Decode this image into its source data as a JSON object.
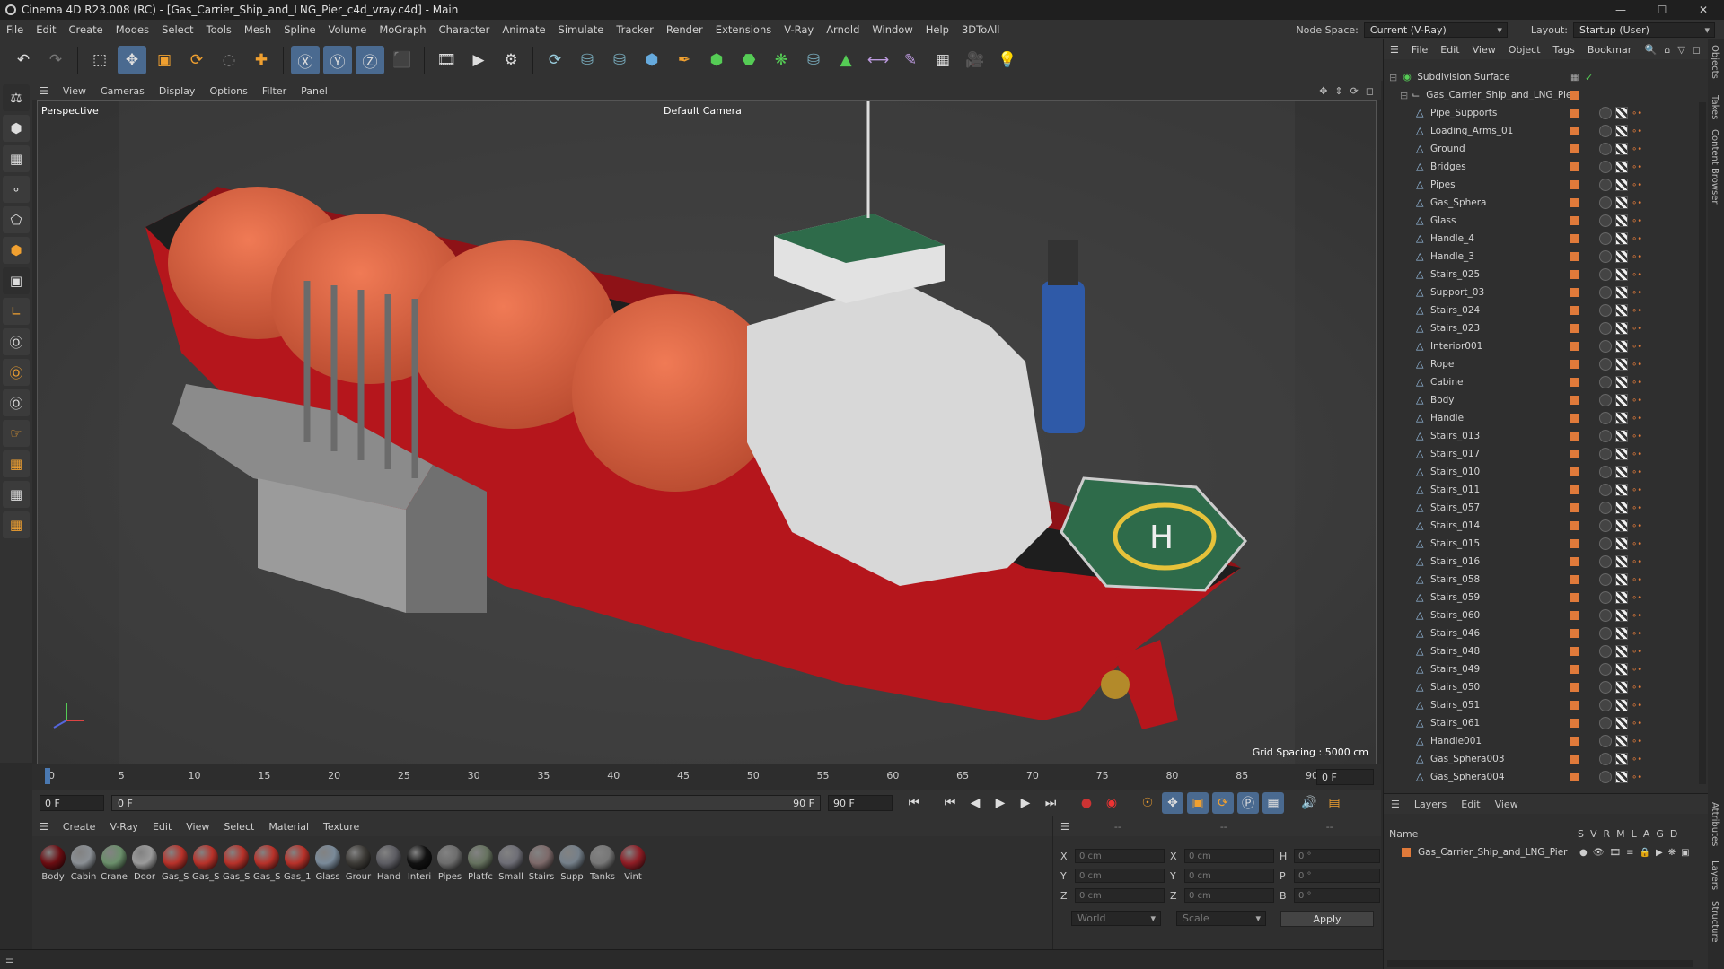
{
  "title": "Cinema 4D R23.008 (RC) - [Gas_Carrier_Ship_and_LNG_Pier_c4d_vray.c4d] - Main",
  "menu": [
    "File",
    "Edit",
    "Create",
    "Modes",
    "Select",
    "Tools",
    "Mesh",
    "Spline",
    "Volume",
    "MoGraph",
    "Character",
    "Animate",
    "Simulate",
    "Tracker",
    "Render",
    "Extensions",
    "V-Ray",
    "Arnold",
    "Window",
    "Help",
    "3DToAll"
  ],
  "node_space_label": "Node Space:",
  "node_space_value": "Current (V-Ray)",
  "layout_label": "Layout:",
  "layout_value": "Startup (User)",
  "viewport_menu": [
    "View",
    "Cameras",
    "Display",
    "Options",
    "Filter",
    "Panel"
  ],
  "viewport": {
    "name": "Perspective",
    "camera": "Default Camera",
    "grid_spacing": "Grid Spacing : 5000 cm"
  },
  "timeline": {
    "ticks": [
      "0",
      "5",
      "10",
      "15",
      "20",
      "25",
      "30",
      "35",
      "40",
      "45",
      "50",
      "55",
      "60",
      "65",
      "70",
      "75",
      "80",
      "85",
      "90"
    ],
    "current_frame": "0 F"
  },
  "transport": {
    "start": "0 F",
    "range_start": "0 F",
    "range_end": "90 F",
    "end": "90 F"
  },
  "material_menu": [
    "Create",
    "V-Ray",
    "Edit",
    "View",
    "Select",
    "Material",
    "Texture"
  ],
  "materials": [
    {
      "name": "Body",
      "color": "#6b0d12"
    },
    {
      "name": "Cabin",
      "color": "#8a8f94"
    },
    {
      "name": "Crane",
      "color": "#6b8f6b"
    },
    {
      "name": "Door",
      "color": "#9a9a9a"
    },
    {
      "name": "Gas_S",
      "color": "#b8322a"
    },
    {
      "name": "Gas_S",
      "color": "#b8322a"
    },
    {
      "name": "Gas_S",
      "color": "#b8322a"
    },
    {
      "name": "Gas_S",
      "color": "#b8322a"
    },
    {
      "name": "Gas_1",
      "color": "#b8322a"
    },
    {
      "name": "Glass",
      "color": "#7a8a99"
    },
    {
      "name": "Grour",
      "color": "#3c3a36"
    },
    {
      "name": "Hand",
      "color": "#5d5d63"
    },
    {
      "name": "Interi",
      "color": "#111111"
    },
    {
      "name": "Pipes",
      "color": "#6d6d6d"
    },
    {
      "name": "Platfc",
      "color": "#66725f"
    },
    {
      "name": "Small",
      "color": "#6e6e76"
    },
    {
      "name": "Stairs",
      "color": "#7d6a6a"
    },
    {
      "name": "Supp",
      "color": "#75808a"
    },
    {
      "name": "Tanks",
      "color": "#777777"
    },
    {
      "name": "Vint",
      "color": "#8f1d25"
    }
  ],
  "coords": {
    "x_pos": "0 cm",
    "y_pos": "0 cm",
    "z_pos": "0 cm",
    "x_size": "0 cm",
    "y_size": "0 cm",
    "z_size": "0 cm",
    "h": "0 °",
    "p": "0 °",
    "b": "0 °",
    "mode1": "World",
    "mode2": "Scale",
    "apply": "Apply",
    "header1": "--",
    "header2": "--",
    "header3": "--"
  },
  "object_menu": [
    "File",
    "Edit",
    "View",
    "Object",
    "Tags",
    "Bookmar"
  ],
  "objects_root": "Subdivision Surface",
  "objects_group": "Gas_Carrier_Ship_and_LNG_Pier",
  "objects": [
    "Pipe_Supports",
    "Loading_Arms_01",
    "Ground",
    "Bridges",
    "Pipes",
    "Gas_Sphera",
    "Glass",
    "Handle_4",
    "Handle_3",
    "Stairs_025",
    "Support_03",
    "Stairs_024",
    "Stairs_023",
    "Interior001",
    "Rope",
    "Cabine",
    "Body",
    "Handle",
    "Stairs_013",
    "Stairs_017",
    "Stairs_010",
    "Stairs_011",
    "Stairs_057",
    "Stairs_014",
    "Stairs_015",
    "Stairs_016",
    "Stairs_058",
    "Stairs_059",
    "Stairs_060",
    "Stairs_046",
    "Stairs_048",
    "Stairs_049",
    "Stairs_050",
    "Stairs_051",
    "Stairs_061",
    "Handle001",
    "Gas_Sphera003",
    "Gas_Sphera004"
  ],
  "layer_menu": [
    "Layers",
    "Edit",
    "View"
  ],
  "layer_headers": {
    "name": "Name",
    "cols": [
      "S",
      "V",
      "R",
      "M",
      "L",
      "A",
      "G",
      "D"
    ]
  },
  "layer_row": "Gas_Carrier_Ship_and_LNG_Pier",
  "side_tabs": [
    "Objects",
    "Takes",
    "Content Browser",
    "Attributes",
    "Layers",
    "Structure"
  ]
}
